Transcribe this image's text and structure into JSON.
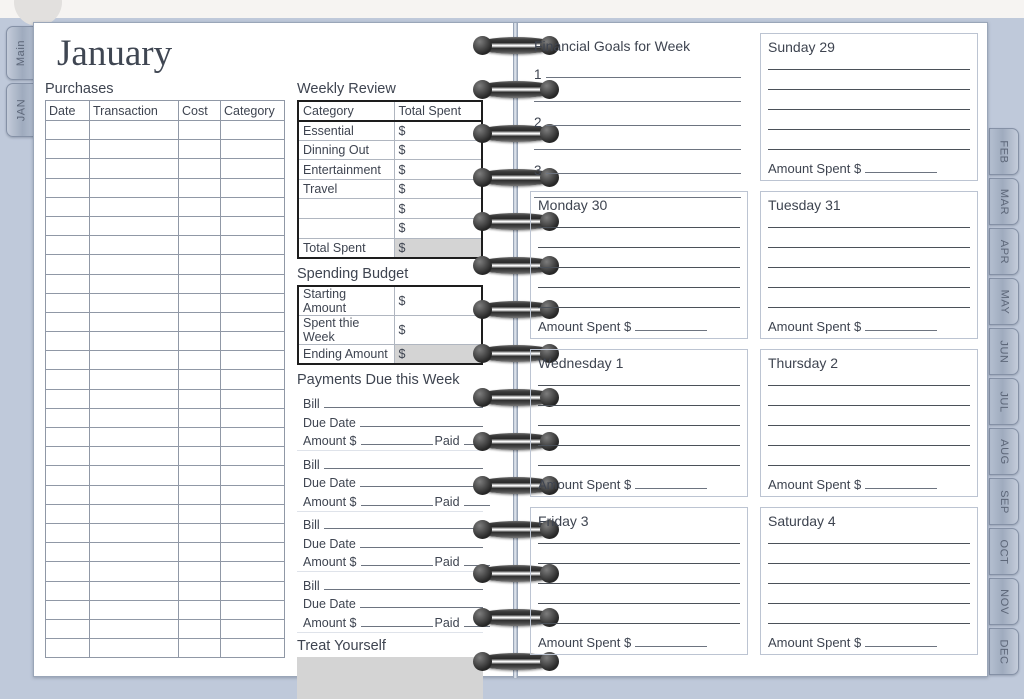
{
  "app": {
    "background_color": "#bfc9da",
    "page_color": "#ffffff",
    "accent_color": "#9fabbe",
    "shade_color": "#d4d4d4"
  },
  "left_tabs": [
    {
      "label": "Main"
    },
    {
      "label": "JAN"
    }
  ],
  "right_tabs": [
    {
      "label": "FEB"
    },
    {
      "label": "MAR"
    },
    {
      "label": "APR"
    },
    {
      "label": "MAY"
    },
    {
      "label": "JUN"
    },
    {
      "label": "JUL"
    },
    {
      "label": "AUG"
    },
    {
      "label": "SEP"
    },
    {
      "label": "OCT"
    },
    {
      "label": "NOV"
    },
    {
      "label": "DEC"
    }
  ],
  "left_page": {
    "month_title": "January",
    "purchases": {
      "heading": "Purchases",
      "columns": [
        "Date",
        "Transaction",
        "Cost",
        "Category"
      ],
      "empty_row_count": 28,
      "rows": []
    },
    "weekly_review": {
      "heading": "Weekly Review",
      "columns": [
        "Category",
        "Total Spent"
      ],
      "rows": [
        {
          "label": "Essential",
          "value": "$"
        },
        {
          "label": "Dinning Out",
          "value": "$"
        },
        {
          "label": "Entertainment",
          "value": "$"
        },
        {
          "label": "Travel",
          "value": "$"
        },
        {
          "label": "",
          "value": "$"
        },
        {
          "label": "",
          "value": "$"
        }
      ],
      "total_row": {
        "label": "Total Spent",
        "value": "$"
      }
    },
    "spending_budget": {
      "heading": "Spending Budget",
      "rows": [
        {
          "label": "Starting Amount",
          "value": "$"
        },
        {
          "label": "Spent thie Week",
          "value": "$"
        },
        {
          "label": "Ending Amount",
          "value": "$",
          "shaded": true
        }
      ]
    },
    "payments_due": {
      "heading": "Payments Due this Week",
      "field_labels": {
        "bill": "Bill",
        "due_date": "Due Date",
        "amount": "Amount $",
        "paid": "Paid"
      },
      "block_count": 4
    },
    "treat_yourself": {
      "heading": "Treat Yourself"
    }
  },
  "right_page": {
    "goals": {
      "heading": "Financial Goals for Week",
      "items": [
        "1",
        "2",
        "3"
      ]
    },
    "amount_spent_label": "Amount Spent $",
    "days": [
      {
        "title": "Sunday 29",
        "line_count": 5
      },
      {
        "title": "Monday 30",
        "line_count": 5
      },
      {
        "title": "Tuesday 31",
        "line_count": 5
      },
      {
        "title": "Wednesday 1",
        "line_count": 5
      },
      {
        "title": "Thursday 2",
        "line_count": 5
      },
      {
        "title": "Friday 3",
        "line_count": 5
      },
      {
        "title": "Saturday 4",
        "line_count": 5
      }
    ]
  }
}
